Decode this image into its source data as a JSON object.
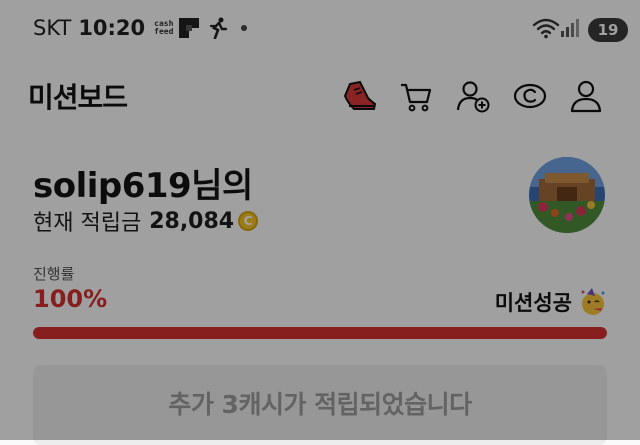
{
  "status_bar": {
    "carrier": "SKT",
    "time": "10:20",
    "app_icons": [
      "cashfeed-icon",
      "flipboard-icon",
      "runner-icon"
    ],
    "battery": "19"
  },
  "header": {
    "title": "미션보드",
    "icons": [
      "sneaker-icon",
      "cart-icon",
      "add-friend-icon",
      "cash-coin-icon",
      "profile-icon"
    ]
  },
  "profile": {
    "name": "solip619님의",
    "balance_label": "현재 적립금",
    "balance_value": "28,084",
    "coin_symbol": "C"
  },
  "progress": {
    "label": "진행률",
    "value": "100%",
    "percent": 100,
    "status": "미션성공",
    "status_icon": "party-face-icon"
  },
  "banner": {
    "text": "추가 3캐시가 적립되었습니다"
  },
  "colors": {
    "accent": "#d43131",
    "coin": "#f2c228"
  }
}
